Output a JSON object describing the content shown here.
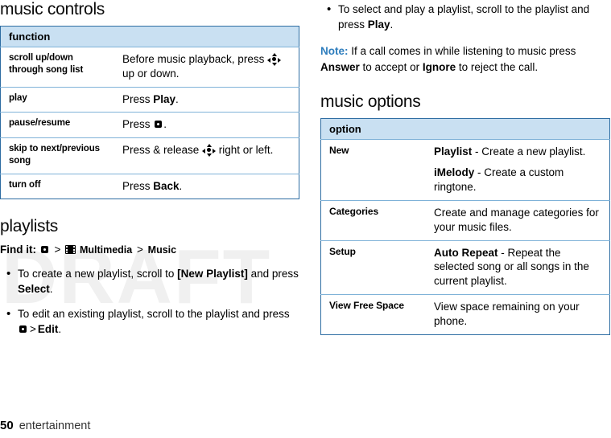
{
  "watermark": "DRAFT",
  "left": {
    "heading_music_controls": "music controls",
    "controls_table": {
      "header": "function",
      "rows": [
        {
          "key": "scroll up/down through song list",
          "value_pre": "Before music playback, press ",
          "value_post": " up or down."
        },
        {
          "key": "play",
          "value_pre": "Press ",
          "value_bold": "Play",
          "value_post": "."
        },
        {
          "key": "pause/resume",
          "value_pre": "Press ",
          "value_post": "."
        },
        {
          "key": "skip to next/previous song",
          "value_pre": "Press & release ",
          "value_post": " right or left."
        },
        {
          "key": "turn off",
          "value_pre": "Press ",
          "value_bold": "Back",
          "value_post": "."
        }
      ]
    },
    "heading_playlists": "playlists",
    "find_it": {
      "label": "Find it:",
      "sep1": ">",
      "multimedia": "Multimedia",
      "sep2": ">",
      "music": "Music"
    },
    "bullets": [
      {
        "pre": "To create a new playlist, scroll to ",
        "bold1": "[New Playlist]",
        "mid": " and press ",
        "bold2": "Select",
        "post": "."
      },
      {
        "pre": "To edit an existing playlist, scroll to the playlist and press ",
        "sep": ">",
        "bold2": "Edit",
        "post": "."
      }
    ]
  },
  "right": {
    "bullets": [
      {
        "pre": "To select and play a playlist, scroll to the playlist and press ",
        "bold": "Play",
        "post": "."
      }
    ],
    "note": {
      "label": "Note:",
      "pre": " If a call comes in while listening to music press ",
      "bold1": "Answer",
      "mid": " to accept or ",
      "bold2": "Ignore",
      "post": " to reject the call."
    },
    "heading_music_options": "music options",
    "options_table": {
      "header": "option",
      "rows": [
        {
          "key": "New",
          "lines": [
            {
              "bold": "Playlist",
              "text": " - Create a new playlist."
            },
            {
              "bold": "iMelody",
              "text": " - Create a custom ringtone."
            }
          ]
        },
        {
          "key": "Categories",
          "lines": [
            {
              "bold": "",
              "text": "Create and manage categories for your music files."
            }
          ]
        },
        {
          "key": "Setup",
          "lines": [
            {
              "bold": "Auto Repeat",
              "text": " - Repeat the selected song or all songs in the current playlist."
            }
          ]
        },
        {
          "key": "View Free Space",
          "lines": [
            {
              "bold": "",
              "text": "View space remaining on your phone."
            }
          ]
        }
      ]
    }
  },
  "footer": {
    "page_number": "50",
    "section": "entertainment"
  },
  "colors": {
    "table_border": "#2d6ca2",
    "header_fill": "#c9e0f2",
    "note_label": "#2d7dbd",
    "watermark": "#f0f0f0"
  }
}
